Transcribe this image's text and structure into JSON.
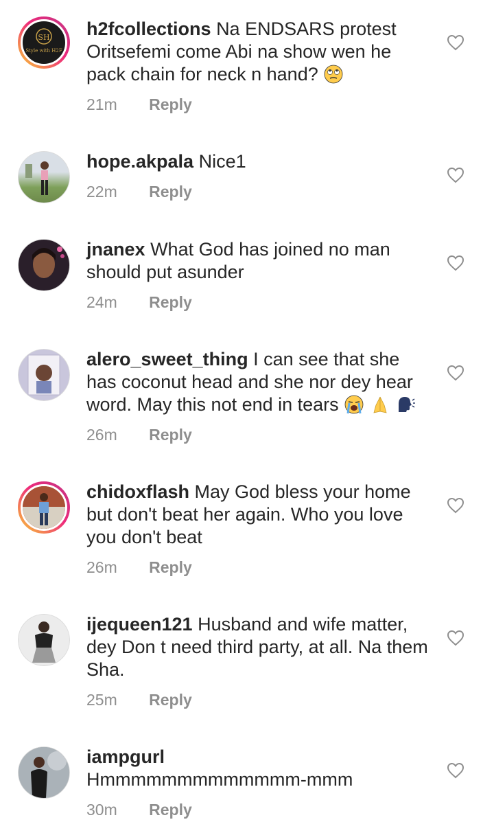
{
  "comments": [
    {
      "username": "h2fcollections",
      "text": "Na ENDSARS protest Oritsefemi come Abi na show wen he pack chain for neck n hand?",
      "emojis": [
        "face-with-rolling-eyes"
      ],
      "time": "21m",
      "reply_label": "Reply",
      "avatar_logo": "Style with H2F",
      "avatar_logo_initials": "SH"
    },
    {
      "username": "hope.akpala",
      "text": "Nice1",
      "time": "22m",
      "reply_label": "Reply"
    },
    {
      "username": "jnanex",
      "text": "What God has joined no man should put asunder",
      "time": "24m",
      "reply_label": "Reply"
    },
    {
      "username": "alero_sweet_thing",
      "text": "I can see that she has coconut head and she nor dey hear word. May this not end in tears",
      "emojis": [
        "loudly-crying-face",
        "folded-hands",
        "speaking-head"
      ],
      "time": "26m",
      "reply_label": "Reply"
    },
    {
      "username": "chidoxflash",
      "text": "May God bless your home but don't beat her again. Who you love you don't beat",
      "time": "26m",
      "reply_label": "Reply"
    },
    {
      "username": "ijequeen121",
      "text": "Husband and wife matter, dey Don t need third party, at all. Na them Sha.",
      "time": "25m",
      "reply_label": "Reply"
    },
    {
      "username": "iampgurl",
      "text": "Hmmmmmmmmmmmmm-mmm",
      "time": "30m",
      "reply_label": "Reply"
    }
  ],
  "colors": {
    "text": "#262626",
    "meta": "#8e8e8e",
    "heart": "#8e8e8e"
  }
}
